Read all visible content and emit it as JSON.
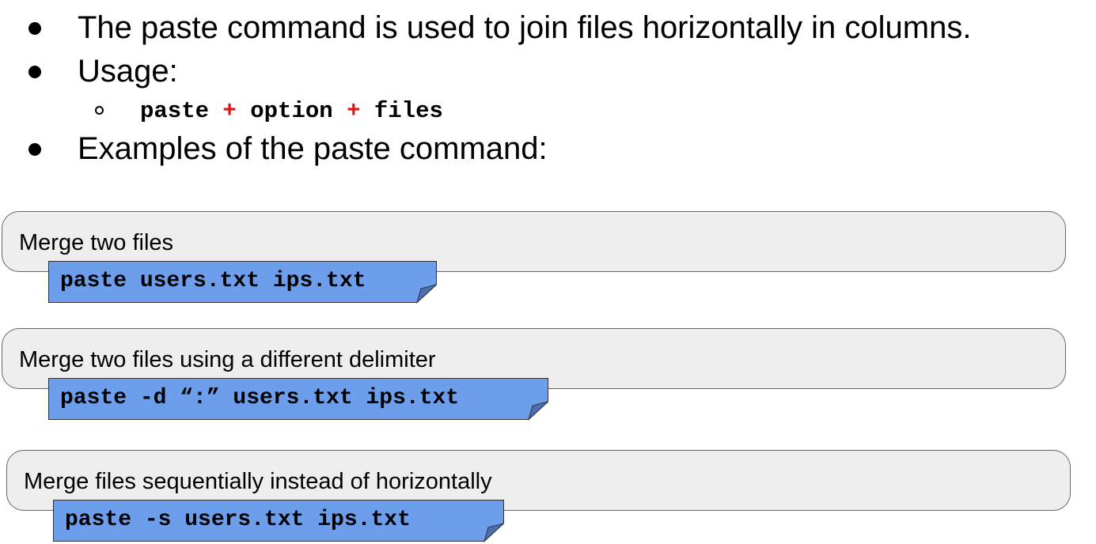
{
  "bullets": {
    "intro": "The paste command is used to join files horizontally in columns.",
    "usage": "Usage:",
    "examples": "Examples of the paste command:"
  },
  "usage_syntax": {
    "cmd": "paste",
    "plus": "+",
    "option": "option",
    "files": "files"
  },
  "examples": [
    {
      "label": "Merge two files",
      "command": "paste users.txt ips.txt"
    },
    {
      "label": "Merge two files using a different delimiter",
      "command": "paste -d “:” users.txt ips.txt"
    },
    {
      "label": "Merge files sequentially instead of horizontally",
      "command": "paste -s users.txt ips.txt"
    }
  ],
  "colors": {
    "card_fill": "#eeeeee",
    "card_border": "#666666",
    "note_fill": "#6d9eeb",
    "note_fold": "#4a6fb3",
    "plus": "#e01414"
  }
}
